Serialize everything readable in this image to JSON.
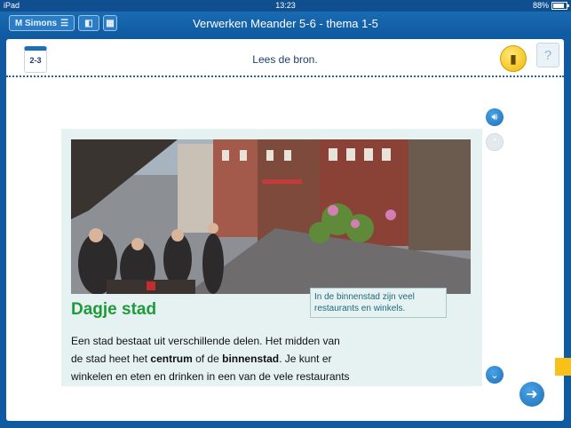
{
  "status": {
    "device": "iPad",
    "time": "13:23",
    "battery": "88%"
  },
  "appbar": {
    "title": "Verwerken Meander 5-6 - thema 1-5",
    "brand_label": "M Simons"
  },
  "lesson": {
    "tag": "2-3",
    "instruction": "Lees de bron."
  },
  "source": {
    "heading": "Dagje stad",
    "caption": "In de binnenstad zijn veel restaurants en winkels.",
    "body": [
      {
        "text": "Een stad bestaat uit verschillende delen. Het midden van"
      },
      {
        "text_pre": "de stad heet het ",
        "term1": "centrum",
        "text_mid": " of de ",
        "term2": "binnenstad",
        "text_post": ". Je kunt er"
      },
      {
        "text": "winkelen en eten en drinken in een van de vele restaurants"
      }
    ]
  },
  "icons": {
    "menu": "menu-icon",
    "layout": "layout-icon",
    "calculator": "calculator-icon",
    "sound": "speaker-icon",
    "up": "chevron-up-icon",
    "down": "chevron-down-icon",
    "next": "arrow-right-icon",
    "help": "help-icon"
  },
  "colors": {
    "accent": "#1d6fb8",
    "heading": "#1f9a3a",
    "panel": "#e6f1f2"
  }
}
